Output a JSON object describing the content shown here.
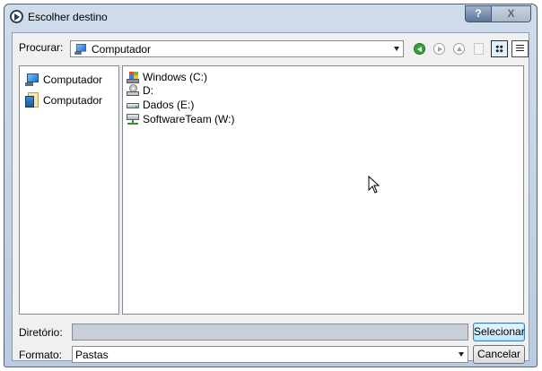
{
  "window": {
    "title": "Escolher destino"
  },
  "caption": {
    "help_label": "?",
    "close_label": "X"
  },
  "toolbar": {
    "look_in_label": "Procurar:",
    "look_in_value": "Computador",
    "back_icon": "back-icon",
    "forward_icon": "forward-icon",
    "up_icon": "up-folder-icon",
    "new_folder_icon": "new-folder-icon",
    "list_view_icon": "list-view-icon",
    "details_view_icon": "details-view-icon"
  },
  "sidebar": {
    "items": [
      {
        "label": "Computador",
        "icon": "computer-icon"
      },
      {
        "label": "Computador",
        "icon": "documents-icon"
      }
    ]
  },
  "files": {
    "items": [
      {
        "label": "Windows (C:)",
        "icon": "windows-drive-icon"
      },
      {
        "label": "D:",
        "icon": "dvd-drive-icon"
      },
      {
        "label": "Dados (E:)",
        "icon": "hard-drive-icon"
      },
      {
        "label": "SoftwareTeam (W:)",
        "icon": "network-drive-icon"
      }
    ]
  },
  "footer": {
    "directory_label": "Diretório:",
    "directory_value": "",
    "format_label": "Formato:",
    "format_value": "Pastas",
    "select_button": "Selecionar",
    "cancel_button": "Cancelar"
  }
}
